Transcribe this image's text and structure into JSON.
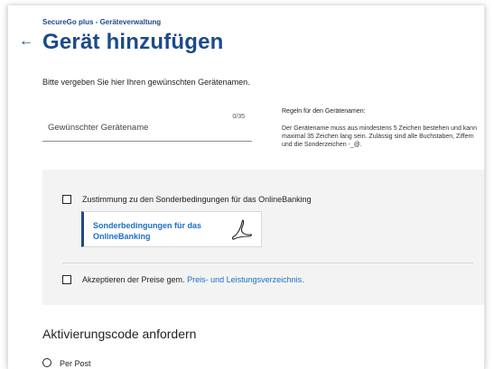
{
  "header": {
    "app_title": "SecureGo plus - Geräteverwaltung",
    "back_icon": "←",
    "page_title": "Gerät hinzufügen"
  },
  "form": {
    "intro": "Bitte vergeben Sie hier Ihren gewünschten Gerätenamen.",
    "name_field": {
      "placeholder": "Gewünschter Gerätename",
      "value": "",
      "counter": "0/35"
    },
    "rules": {
      "heading": "Regeln für den Gerätenamen:",
      "text": "Der Gerätename muss aus mindestens 5 Zeichen bestehen und kann maximal 35 Zeichen lang sein. Zulässig sind alle Buchstaben, Ziffern und die Sonderzeichen -_@."
    }
  },
  "consent": {
    "terms_checkbox_label": "Zustimmung zu den Sonderbedingungen für das OnlineBanking",
    "terms_checked": false,
    "pdf_link_label": "Sonderbedingungen für das OnlineBanking",
    "pdf_icon": "pdf-icon",
    "prices_checkbox_prefix": "Akzeptieren der Preise gem. ",
    "prices_link_label": "Preis- und Leistungsverzeichnis.",
    "prices_checked": false
  },
  "activation": {
    "title": "Aktivierungscode anfordern",
    "options": [
      {
        "label": "Per Post",
        "selected": false
      }
    ]
  },
  "colors": {
    "brand": "#1c4a8a",
    "link": "#1c6fc4",
    "panel_bg": "#f3f3f3"
  }
}
